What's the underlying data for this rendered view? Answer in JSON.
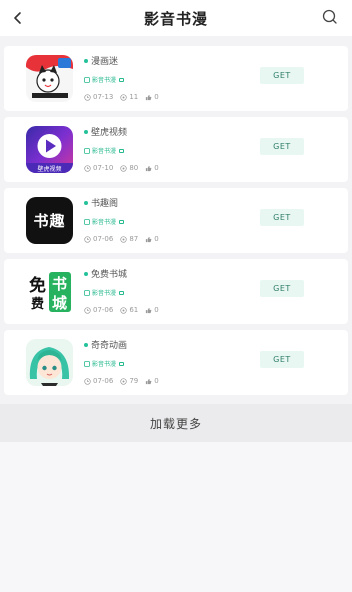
{
  "header": {
    "title": "影音书漫",
    "back_icon": "chevron-left-icon",
    "search_icon": "search-icon"
  },
  "colors": {
    "accent": "#24c29a",
    "get_bg": "#e9f7f2",
    "card_bg": "#ffffff",
    "page_bg": "#f3f3f5"
  },
  "apps": [
    {
      "name": "漫画迷",
      "tag": "影音书漫",
      "date": "07-13",
      "views": "11",
      "likes": "0",
      "get_label": "GET",
      "icon": "manhuami-app-icon"
    },
    {
      "name": "壁虎视频",
      "tag": "影音书漫",
      "date": "07-10",
      "views": "80",
      "likes": "0",
      "get_label": "GET",
      "icon": "bihu-video-app-icon",
      "icon_caption": "壁虎视频"
    },
    {
      "name": "书趣阁",
      "tag": "影音书漫",
      "date": "07-06",
      "views": "87",
      "likes": "0",
      "get_label": "GET",
      "icon": "shuqu-app-icon",
      "icon_text": "书趣"
    },
    {
      "name": "免费书城",
      "tag": "影音书漫",
      "date": "07-06",
      "views": "61",
      "likes": "0",
      "get_label": "GET",
      "icon": "free-bookstore-app-icon",
      "icon_text_left": "免",
      "icon_text_left2": "费",
      "icon_text_right": "书",
      "icon_text_right2": "城"
    },
    {
      "name": "奇奇动画",
      "tag": "影音书漫",
      "date": "07-06",
      "views": "79",
      "likes": "0",
      "get_label": "GET",
      "icon": "qiqi-anime-app-icon"
    }
  ],
  "load_more": "加载更多"
}
